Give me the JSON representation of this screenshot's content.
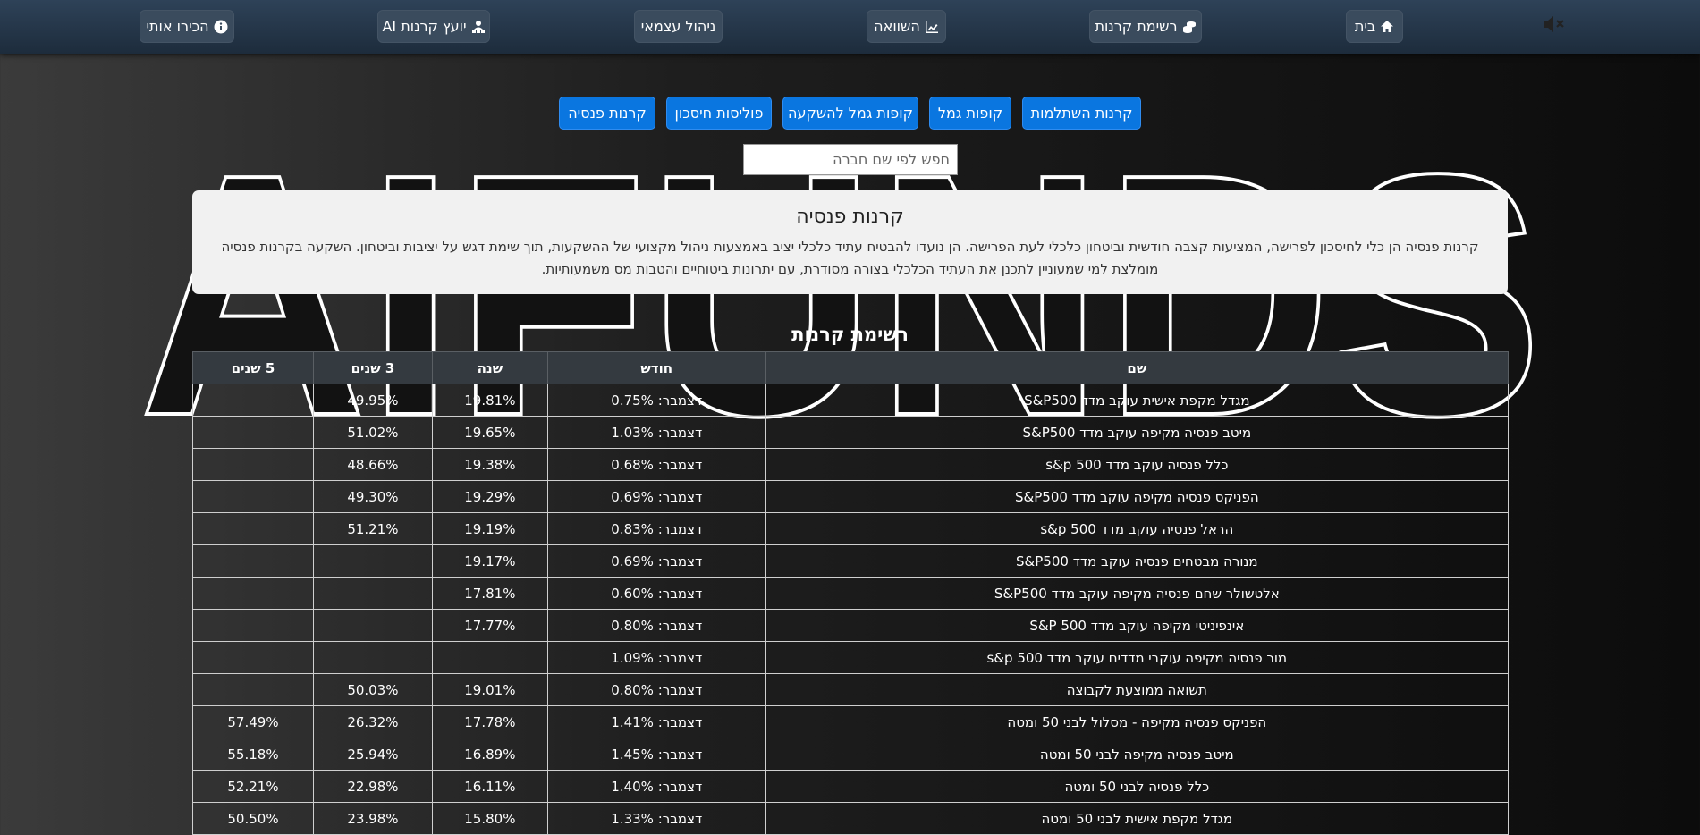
{
  "nav": {
    "home": "בית",
    "funds_list": "רשימת קרנות",
    "compare": "השוואה",
    "self_manage": "ניהול עצמאי",
    "ai_advisor": "יועץ קרנות AI",
    "about": "הכירו אותי"
  },
  "watermark_text": "AIFUNDS",
  "categories": {
    "hishtalmut": "קרנות השתלמות",
    "gemel": "קופות גמל",
    "gemel_invest": "קופות גמל להשקעה",
    "savings_policies": "פוליסות חיסכון",
    "pension": "קרנות פנסיה"
  },
  "search": {
    "placeholder": "חפש לפי שם חברה"
  },
  "card": {
    "title": "קרנות פנסיה",
    "line1": "קרנות פנסיה הן כלי לחיסכון לפרישה, המציעות קצבה חודשית וביטחון כלכלי לעת הפרישה. הן נועדו להבטיח עתיד כלכלי יציב באמצעות ניהול מקצועי של ההשקעות, תוך שימת דגש על יציבות וביטחון. השקעה בקרנות פנסיה",
    "line2": "מומלצת למי שמעוניין לתכנן את העתיד הכלכלי בצורה מסודרת, עם יתרונות ביטוחיים והטבות מס משמעותיות."
  },
  "list_title": "רשימת קרנות",
  "table": {
    "headers": {
      "name": "שם",
      "month": "חודש",
      "year": "שנה",
      "three_years": "3 שנים",
      "five_years": "5 שנים"
    },
    "rows": [
      {
        "name": "מגדל מקפת אישית עוקב מדד S&P500",
        "month": "דצמבר: 0.75%",
        "year": "19.81%",
        "three_years": "49.95%",
        "five_years": ""
      },
      {
        "name": "מיטב פנסיה מקיפה עוקב מדד S&P500",
        "month": "דצמבר: 1.03%",
        "year": "19.65%",
        "three_years": "51.02%",
        "five_years": ""
      },
      {
        "name": "כלל פנסיה עוקב מדד s&p 500",
        "month": "דצמבר: 0.68%",
        "year": "19.38%",
        "three_years": "48.66%",
        "five_years": ""
      },
      {
        "name": "הפניקס פנסיה מקיפה עוקב מדד S&P500",
        "month": "דצמבר: 0.69%",
        "year": "19.29%",
        "three_years": "49.30%",
        "five_years": ""
      },
      {
        "name": "הראל פנסיה עוקב מדד s&p 500",
        "month": "דצמבר: 0.83%",
        "year": "19.19%",
        "three_years": "51.21%",
        "five_years": ""
      },
      {
        "name": "מנורה מבטחים פנסיה עוקב מדד S&P500",
        "month": "דצמבר: 0.69%",
        "year": "19.17%",
        "three_years": "",
        "five_years": ""
      },
      {
        "name": "אלטשולר שחם פנסיה מקיפה עוקב מדד S&P500",
        "month": "דצמבר: 0.60%",
        "year": "17.81%",
        "three_years": "",
        "five_years": ""
      },
      {
        "name": "אינפיניטי מקיפה עוקב מדד S&P 500",
        "month": "דצמבר: 0.80%",
        "year": "17.77%",
        "three_years": "",
        "five_years": ""
      },
      {
        "name": "מור פנסיה מקיפה עוקבי מדדים עוקב מדד s&p 500",
        "month": "דצמבר: 1.09%",
        "year": "",
        "three_years": "",
        "five_years": ""
      },
      {
        "name": "תשואה ממוצעת לקבוצה",
        "month": "דצמבר: 0.80%",
        "year": "19.01%",
        "three_years": "50.03%",
        "five_years": ""
      },
      {
        "name": "הפניקס פנסיה מקיפה - מסלול לבני 50 ומטה",
        "month": "דצמבר: 1.41%",
        "year": "17.78%",
        "three_years": "26.32%",
        "five_years": "57.49%"
      },
      {
        "name": "מיטב פנסיה מקיפה לבני 50 ומטה",
        "month": "דצמבר: 1.45%",
        "year": "16.89%",
        "three_years": "25.94%",
        "five_years": "55.18%"
      },
      {
        "name": "כלל פנסיה לבני 50 ומטה",
        "month": "דצמבר: 1.40%",
        "year": "16.11%",
        "three_years": "22.98%",
        "five_years": "52.21%"
      },
      {
        "name": "מגדל מקפת אישית לבני 50 ומטה",
        "month": "דצמבר: 1.33%",
        "year": "15.80%",
        "three_years": "23.98%",
        "five_years": "50.50%"
      }
    ]
  }
}
